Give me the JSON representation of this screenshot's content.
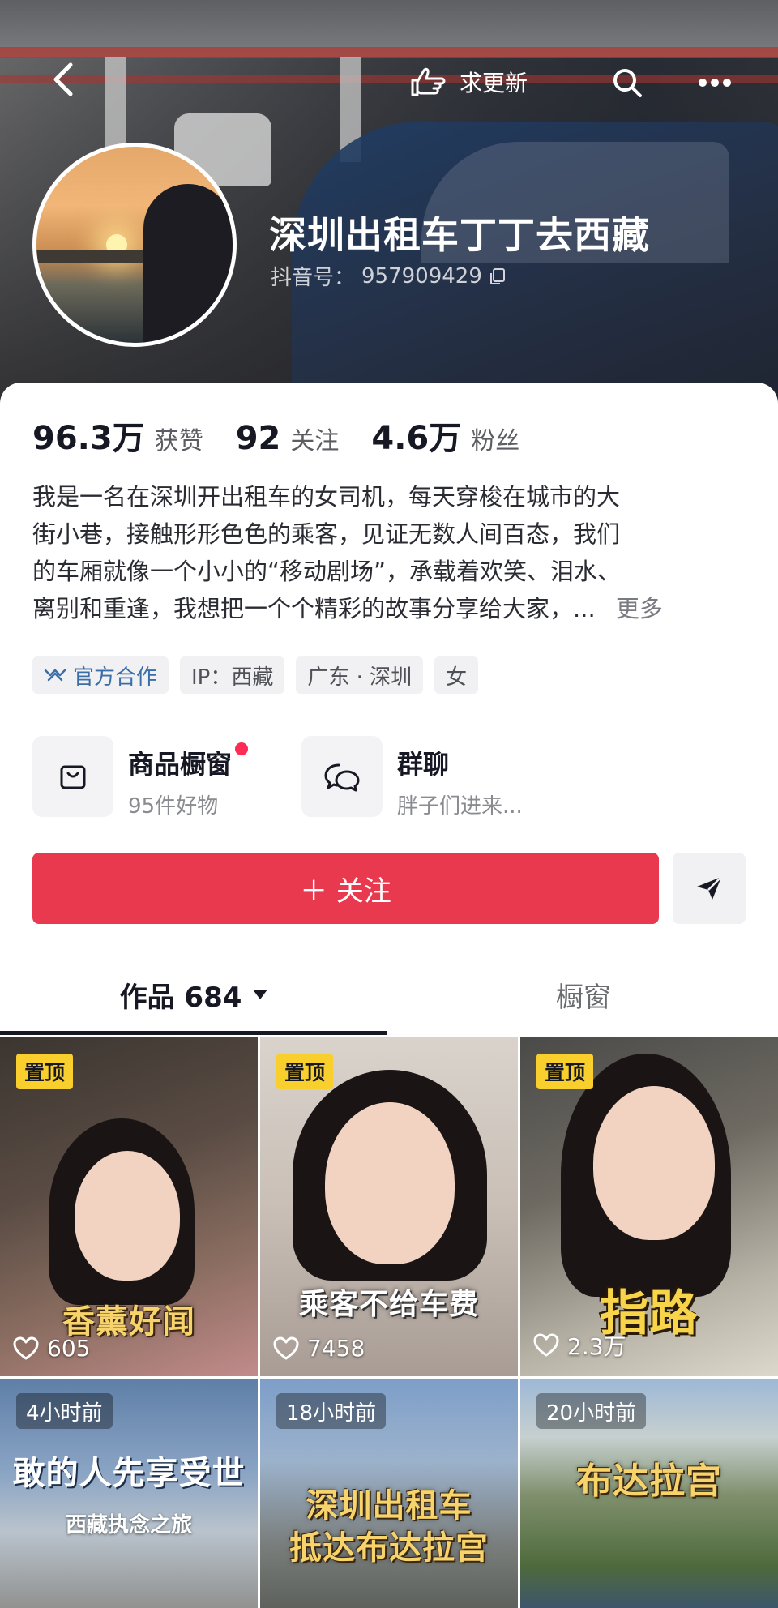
{
  "header": {
    "request_update_label": "求更新",
    "nickname": "深圳出租车丁丁去西藏",
    "douyin_id_prefix": "抖音号：",
    "douyin_id_value": "957909429"
  },
  "stats": [
    {
      "value": "96.3万",
      "label": "获赞"
    },
    {
      "value": "92",
      "label": "关注"
    },
    {
      "value": "4.6万",
      "label": "粉丝"
    }
  ],
  "bio": {
    "lines": [
      "我是一名在深圳开出租车的女司机，每天穿梭在城市的大",
      "街小巷，接触形形色色的乘客，见证无数人间百态，我们",
      "的车厢就像一个小小的“移动剧场”，承载着欢笑、泪水、",
      "离别和重逢，我想把一个个精彩的故事分享给大家，..."
    ],
    "more_label": "更多"
  },
  "tags": {
    "official": "官方合作",
    "ip": "IP：西藏",
    "location": "广东 · 深圳",
    "gender": "女"
  },
  "shortcuts": {
    "shop": {
      "title": "商品橱窗",
      "subtitle": "95件好物"
    },
    "group": {
      "title": "群聊",
      "subtitle": "胖子们进来..."
    }
  },
  "actions": {
    "follow_label": "＋ 关注"
  },
  "tabs": {
    "works_label": "作品 684",
    "showcase_label": "橱窗"
  },
  "videos": [
    {
      "badge": "置顶",
      "caption": "香薰好闻",
      "likes": "605"
    },
    {
      "badge": "置顶",
      "caption": "乘客不给车费",
      "likes": "7458"
    },
    {
      "badge": "置顶",
      "caption": "指路",
      "likes": "2.3万"
    },
    {
      "time": "4小时前",
      "caption": "敢的人先享受世",
      "subcaption": "西藏执念之旅"
    },
    {
      "time": "18小时前",
      "caption_line1": "深圳出租车",
      "caption_line2": "抵达布达拉宫"
    },
    {
      "time": "20小时前",
      "caption": "布达拉宫"
    }
  ],
  "colors": {
    "follow": "#e9394f",
    "pin_badge": "#f9cf2d",
    "red_dot": "#fe2c55",
    "official_tag": "#3a6ea8"
  },
  "icons": [
    "back-arrow-icon",
    "pointing-hand-icon",
    "search-icon",
    "more-dots-icon",
    "copy-icon",
    "handshake-icon",
    "shopping-bag-icon",
    "chat-bubbles-icon",
    "share-send-icon",
    "dropdown-caret-icon",
    "heart-icon"
  ]
}
